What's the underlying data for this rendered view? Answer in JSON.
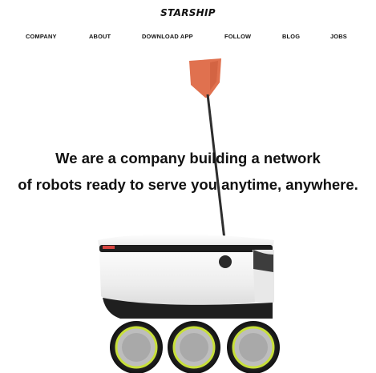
{
  "header": {
    "logo": "STARSHIP"
  },
  "nav": {
    "items": [
      {
        "label": "COMPANY"
      },
      {
        "label": "ABOUT"
      },
      {
        "label": "DOWNLOAD APP"
      },
      {
        "label": "FOLLOW"
      },
      {
        "label": "BLOG"
      },
      {
        "label": "JOBS"
      }
    ]
  },
  "hero": {
    "line1": "We are a company building a network",
    "line2": "of robots ready to serve you anytime, anywhere."
  },
  "colors": {
    "flag": "#e0714f",
    "body": "#f2f2f2",
    "stripe": "#1d1d1d",
    "wheel_ring": "#c8e03a"
  }
}
